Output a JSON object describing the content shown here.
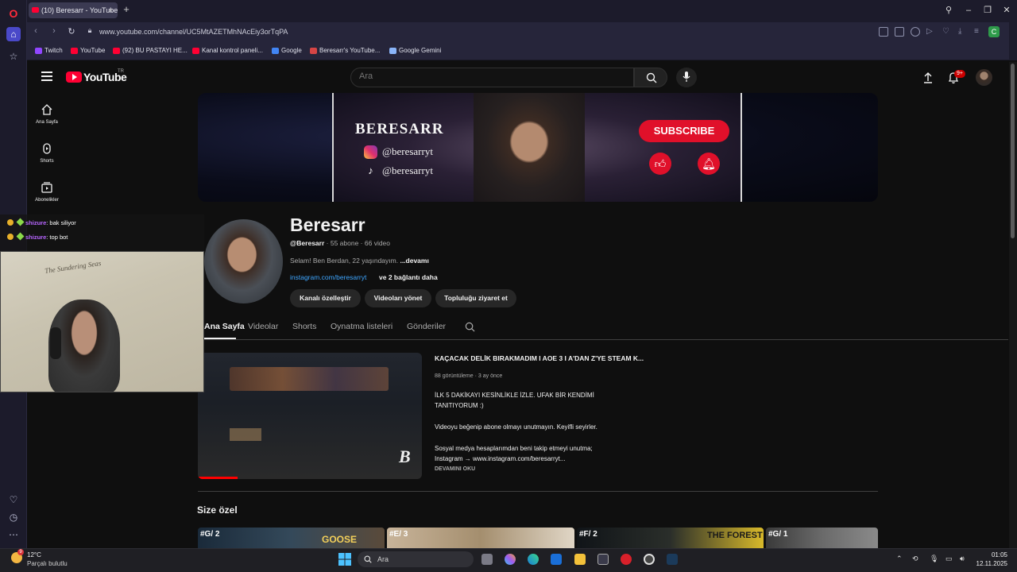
{
  "browser": {
    "tab_title": "(10) Beresarr - YouTube",
    "url": "www.youtube.com/channel/UC5MtAZETMhNAcEiy3orTqPA",
    "profile_initial": "C",
    "bookmarks": [
      {
        "label": "Twitch",
        "color": "#9146ff"
      },
      {
        "label": "YouTube",
        "color": "#ff0033"
      },
      {
        "label": "(92) BU PASTAYI HE...",
        "color": "#ff0033"
      },
      {
        "label": "Kanal kontrol paneli...",
        "color": "#ff0033"
      },
      {
        "label": "Google",
        "color": "#4285f4"
      },
      {
        "label": "Beresarr's YouTube...",
        "color": "#d64545"
      },
      {
        "label": "Google Gemini",
        "color": "#8ab4f8"
      }
    ]
  },
  "youtube": {
    "logo_text": "YouTube",
    "country_code": "TR",
    "search_placeholder": "Ara",
    "notification_count": "9+",
    "guide": [
      {
        "label": "Ana Sayfa",
        "icon": "home-icon"
      },
      {
        "label": "Shorts",
        "icon": "shorts-icon"
      },
      {
        "label": "Abonelikler",
        "icon": "subscriptions-icon"
      }
    ],
    "banner": {
      "name": "BERESARR",
      "instagram": "@beresarryt",
      "tiktok": "@beresarryt",
      "subscribe": "SUBSCRIBE"
    },
    "channel": {
      "title": "Beresarr",
      "handle": "@Beresarr",
      "subscribers": "55 abone",
      "videos": "66 video",
      "description": "Selam! Ben Berdan, 22 yaşındayım.",
      "description_more": "...devamı",
      "link": "instagram.com/beresarryt",
      "link_more": "ve 2 bağlantı daha",
      "buttons": [
        "Kanalı özelleştir",
        "Videoları yönet",
        "Topluluğu ziyaret et"
      ]
    },
    "tabs": [
      "Ana Sayfa",
      "Videolar",
      "Shorts",
      "Oynatma listeleri",
      "Gönderiler"
    ],
    "featured": {
      "title": "KAÇACAK DELİK BIRAKMADIM I AOE 3 I A'DAN Z'YE STEAM K...",
      "views": "88 görüntüleme",
      "age": "3 ay önce",
      "desc_1": "İLK 5 DAKİKAYI KESİNLİKLE İZLE. UFAK BİR KENDİMİ",
      "desc_2": "TANITIYORUM :)",
      "desc_3": "Videoyu beğenip abone olmayı unutmayın. Keyifli seyirler.",
      "desc_4": "Sosyal medya hesaplarımdan beni takip etmeyi unutma;",
      "desc_5": "Instagram → www.instagram.com/beresarryt...",
      "more": "DEVAMINI OKU"
    },
    "section_title": "Size özel",
    "shelf_tags": [
      "#G/ 2",
      "#E/ 3",
      "#F/ 2",
      "#G/ 1"
    ],
    "shelf_labels": [
      "GOOSE",
      "THE FOREST"
    ]
  },
  "chat": [
    {
      "user": "shizure",
      "message": ": bak siliyor"
    },
    {
      "user": "shizure",
      "message": ": top bot"
    }
  ],
  "webcam": {
    "map_text": "The Sundering Seas"
  },
  "taskbar": {
    "temperature": "12°C",
    "weather": "Parçalı bulutlu",
    "weather_badge": "9",
    "search_label": "Ara",
    "time": "01:05",
    "date": "12.11.2025"
  }
}
